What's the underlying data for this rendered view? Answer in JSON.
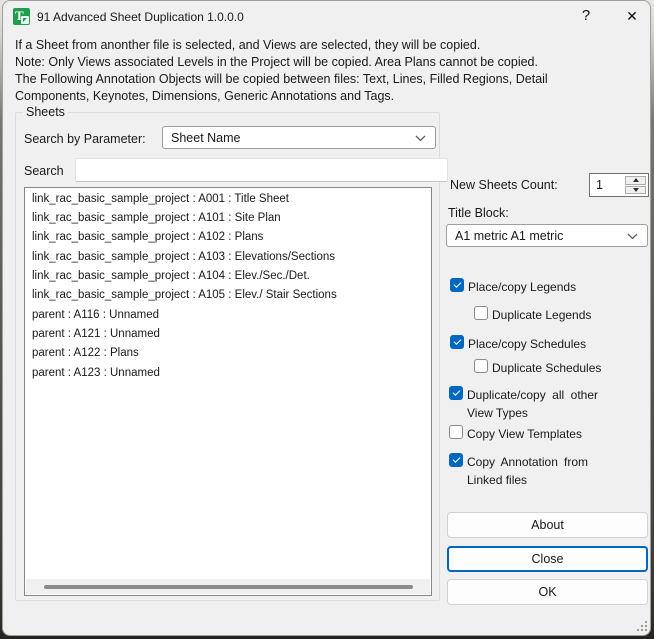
{
  "window": {
    "title": "91 Advanced Sheet Duplication 1.0.0.0",
    "help_button": "?",
    "close_button": "✕"
  },
  "intro": {
    "line1": "If a Sheet from anonther file is selected, and Views are selected, they will be copied.",
    "line2": "Note: Only Views associated Levels in the Project will be copied. Area Plans cannot be copied.",
    "line3": "The Following Annotation Objects will be copied between files: Text, Lines, Filled Regions, Detail",
    "line4": "Components, Keynotes, Dimensions, Generic Annotations and Tags."
  },
  "sheets_group": {
    "label": "Sheets",
    "search_by_parameter_label": "Search by Parameter:",
    "parameter_value": "Sheet Name",
    "search_label": "Search",
    "search_value": "",
    "items": [
      "link_rac_basic_sample_project : A001 : Title Sheet",
      "link_rac_basic_sample_project : A101 : Site Plan",
      "link_rac_basic_sample_project : A102 : Plans",
      "link_rac_basic_sample_project : A103 : Elevations/Sections",
      "link_rac_basic_sample_project : A104 : Elev./Sec./Det.",
      "link_rac_basic_sample_project : A105 : Elev./ Stair Sections",
      "parent : A116 : Unnamed",
      "parent : A121 : Unnamed",
      "parent : A122 : Plans",
      "parent : A123 : Unnamed"
    ]
  },
  "options": {
    "new_sheets_count_label": "New Sheets Count:",
    "new_sheets_count_value": "1",
    "title_block_label": "Title Block:",
    "title_block_value": "A1 metric A1 metric",
    "checkboxes": [
      {
        "label": "Place/copy Legends",
        "checked": true
      },
      {
        "label": "Duplicate Legends",
        "checked": false
      },
      {
        "label": "Place/copy Schedules",
        "checked": true
      },
      {
        "label": "Duplicate Schedules",
        "checked": false
      },
      {
        "label": "Duplicate/copy all other View Types",
        "checked": true
      },
      {
        "label": "Copy View Templates",
        "checked": false
      },
      {
        "label": "Copy Annotation from Linked files",
        "checked": true
      }
    ],
    "buttons": {
      "about": "About",
      "close": "Close",
      "ok": "OK"
    }
  },
  "colors": {
    "accent": "#0067C0",
    "icon_green": "#1f9e4e"
  }
}
